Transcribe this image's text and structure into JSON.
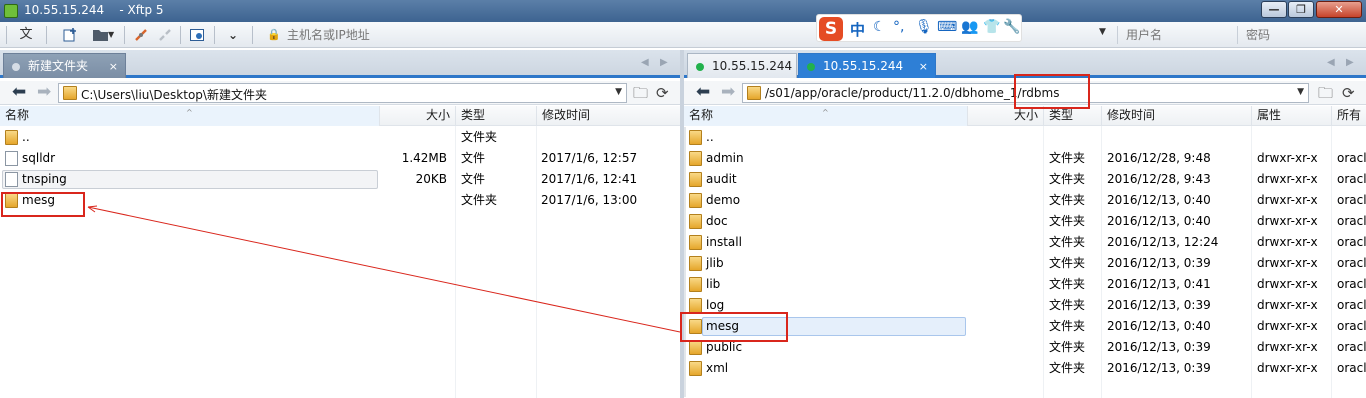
{
  "window": {
    "title": "10.55.15.244    - Xftp 5",
    "min_glyph": "—",
    "max_glyph": "❐",
    "close_glyph": "✕"
  },
  "toolbar": {
    "text_button": "文",
    "host_placeholder": "主机名或IP地址",
    "user_placeholder": "用户名",
    "password_placeholder": "密码"
  },
  "ime": {
    "logo": "S",
    "mode": "中"
  },
  "left_panel": {
    "tab": {
      "label": "新建文件夹",
      "close": "×"
    },
    "path": "C:\\Users\\liu\\Desktop\\新建文件夹",
    "columns": {
      "name": "名称",
      "size": "大小",
      "type": "类型",
      "modified": "修改时间"
    },
    "rows": [
      {
        "name": "..",
        "size": "",
        "type": "文件夹",
        "modified": "",
        "kind": "folder"
      },
      {
        "name": "sqlldr",
        "size": "1.42MB",
        "type": "文件",
        "modified": "2017/1/6, 12:57",
        "kind": "file"
      },
      {
        "name": "tnsping",
        "size": "20KB",
        "type": "文件",
        "modified": "2017/1/6, 12:41",
        "kind": "file"
      },
      {
        "name": "mesg",
        "size": "",
        "type": "文件夹",
        "modified": "2017/1/6, 13:00",
        "kind": "folder"
      }
    ]
  },
  "right_panel": {
    "tabs": [
      {
        "label": "10.55.15.244",
        "active": false,
        "close": ""
      },
      {
        "label": "10.55.15.244",
        "active": true,
        "close": "×"
      }
    ],
    "path": "/s01/app/oracle/product/11.2.0/dbhome_1/rdbms",
    "columns": {
      "name": "名称",
      "size": "大小",
      "type": "类型",
      "modified": "修改时间",
      "attr": "属性",
      "owner": "所有"
    },
    "rows": [
      {
        "name": "..",
        "type": "",
        "modified": "",
        "attr": "",
        "owner": ""
      },
      {
        "name": "admin",
        "type": "文件夹",
        "modified": "2016/12/28, 9:48",
        "attr": "drwxr-xr-x",
        "owner": "oracl"
      },
      {
        "name": "audit",
        "type": "文件夹",
        "modified": "2016/12/28, 9:43",
        "attr": "drwxr-xr-x",
        "owner": "oracl"
      },
      {
        "name": "demo",
        "type": "文件夹",
        "modified": "2016/12/13, 0:40",
        "attr": "drwxr-xr-x",
        "owner": "oracl"
      },
      {
        "name": "doc",
        "type": "文件夹",
        "modified": "2016/12/13, 0:40",
        "attr": "drwxr-xr-x",
        "owner": "oracl"
      },
      {
        "name": "install",
        "type": "文件夹",
        "modified": "2016/12/13, 12:24",
        "attr": "drwxr-xr-x",
        "owner": "oracl"
      },
      {
        "name": "jlib",
        "type": "文件夹",
        "modified": "2016/12/13, 0:39",
        "attr": "drwxr-xr-x",
        "owner": "oracl"
      },
      {
        "name": "lib",
        "type": "文件夹",
        "modified": "2016/12/13, 0:41",
        "attr": "drwxr-xr-x",
        "owner": "oracl"
      },
      {
        "name": "log",
        "type": "文件夹",
        "modified": "2016/12/13, 0:39",
        "attr": "drwxr-xr-x",
        "owner": "oracl"
      },
      {
        "name": "mesg",
        "type": "文件夹",
        "modified": "2016/12/13, 0:40",
        "attr": "drwxr-xr-x",
        "owner": "oracl"
      },
      {
        "name": "public",
        "type": "文件夹",
        "modified": "2016/12/13, 0:39",
        "attr": "drwxr-xr-x",
        "owner": "oracl"
      },
      {
        "name": "xml",
        "type": "文件夹",
        "modified": "2016/12/13, 0:39",
        "attr": "drwxr-xr-x",
        "owner": "oracl"
      }
    ]
  },
  "colors": {
    "annotation": "#d9261c",
    "tab_active": "#2e7fd6",
    "status_dot": "#22b14c"
  }
}
